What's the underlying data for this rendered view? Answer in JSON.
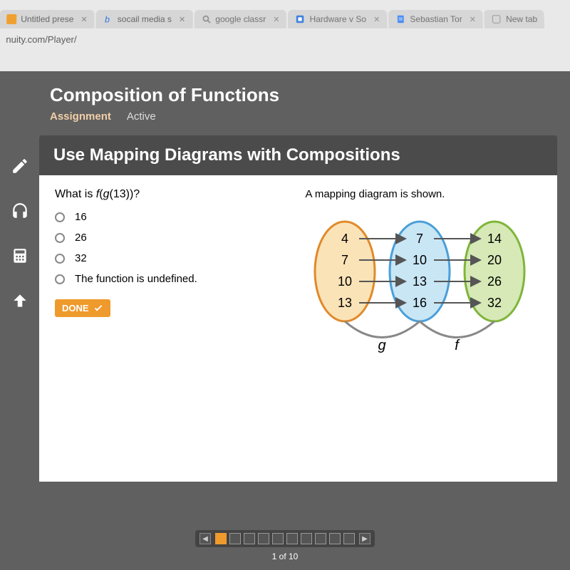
{
  "browser": {
    "tabs": [
      {
        "label": "Untitled prese",
        "favicon_color": "#f0a030"
      },
      {
        "label": "socail media s",
        "favicon_color": "#2a76dd"
      },
      {
        "label": "google classr",
        "favicon_color": "#888888"
      },
      {
        "label": "Hardware v So",
        "favicon_color": "#2a76dd"
      },
      {
        "label": "Sebastian Tor",
        "favicon_color": "#3b82f6"
      },
      {
        "label": "New tab",
        "favicon_color": "#888888"
      }
    ],
    "url": "nuity.com/Player/"
  },
  "page": {
    "title": "Composition of Functions",
    "assignment_label": "Assignment",
    "status": "Active",
    "section_title": "Use Mapping Diagrams with Compositions"
  },
  "question": {
    "prompt": "What is f(g(13))?",
    "options": [
      "16",
      "26",
      "32",
      "The function is undefined."
    ],
    "done_label": "DONE"
  },
  "diagram": {
    "caption": "A mapping diagram is shown.",
    "set1": [
      "4",
      "7",
      "10",
      "13"
    ],
    "set2": [
      "7",
      "10",
      "13",
      "16"
    ],
    "set3": [
      "14",
      "20",
      "26",
      "32"
    ],
    "g_label": "g",
    "f_label": "f"
  },
  "nav": {
    "counter": "1 of 10",
    "total_boxes": 10,
    "active_index": 0
  }
}
